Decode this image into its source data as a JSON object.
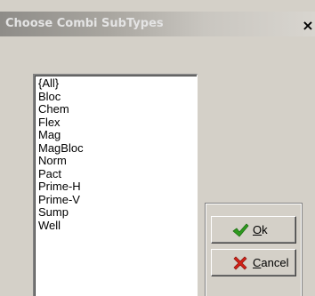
{
  "window": {
    "title": "Choose Combi SubTypes",
    "close_label": "×"
  },
  "list": {
    "items": [
      "{All}",
      "Bloc",
      "Chem",
      "Flex",
      "Mag",
      "MagBloc",
      "Norm",
      "Pact",
      "Prime-H",
      "Prime-V",
      "Sump",
      "Well"
    ]
  },
  "buttons": {
    "ok": {
      "mnemonic": "O",
      "rest": "k",
      "icon": "check-icon",
      "icon_color": "#2e9a1e"
    },
    "cancel": {
      "mnemonic": "C",
      "rest": "ancel",
      "icon": "x-icon",
      "icon_color": "#d42218"
    }
  },
  "colors": {
    "dialog_bg": "#d4d0c8",
    "list_bg": "#ffffff"
  }
}
